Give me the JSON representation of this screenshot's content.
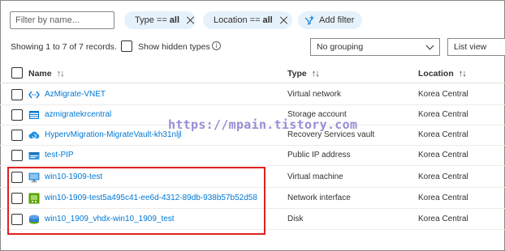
{
  "filter": {
    "placeholder": "Filter by name..."
  },
  "pills": [
    {
      "label": "Type ==",
      "value": "all"
    },
    {
      "label": "Location ==",
      "value": "all"
    }
  ],
  "add_filter_label": "Add filter",
  "records_text": "Showing 1 to 7 of 7 records.",
  "show_hidden_label": "Show hidden types",
  "grouping": {
    "selected": "No grouping"
  },
  "view": {
    "selected": "List view"
  },
  "columns": {
    "name": "Name",
    "type": "Type",
    "location": "Location"
  },
  "rows": [
    {
      "name": "AzMigrate-VNET",
      "type": "Virtual network",
      "location": "Korea Central",
      "icon": "virtual-network-icon"
    },
    {
      "name": "azmigratekrcentral",
      "type": "Storage account",
      "location": "Korea Central",
      "icon": "storage-account-icon"
    },
    {
      "name": "HypervMigration-MigrateVault-kh31nljl",
      "type": "Recovery Services vault",
      "location": "Korea Central",
      "icon": "recovery-vault-icon"
    },
    {
      "name": "test-PIP",
      "type": "Public IP address",
      "location": "Korea Central",
      "icon": "public-ip-icon"
    },
    {
      "name": "win10-1909-test",
      "type": "Virtual machine",
      "location": "Korea Central",
      "icon": "virtual-machine-icon"
    },
    {
      "name": "win10-1909-test5a495c41-ee6d-4312-89db-938b57b52d58",
      "type": "Network interface",
      "location": "Korea Central",
      "icon": "network-interface-icon"
    },
    {
      "name": "win10_1909_vhdx-win10_1909_test",
      "type": "Disk",
      "location": "Korea Central",
      "icon": "disk-icon"
    }
  ],
  "watermark": "https://mpain.tistory.com"
}
